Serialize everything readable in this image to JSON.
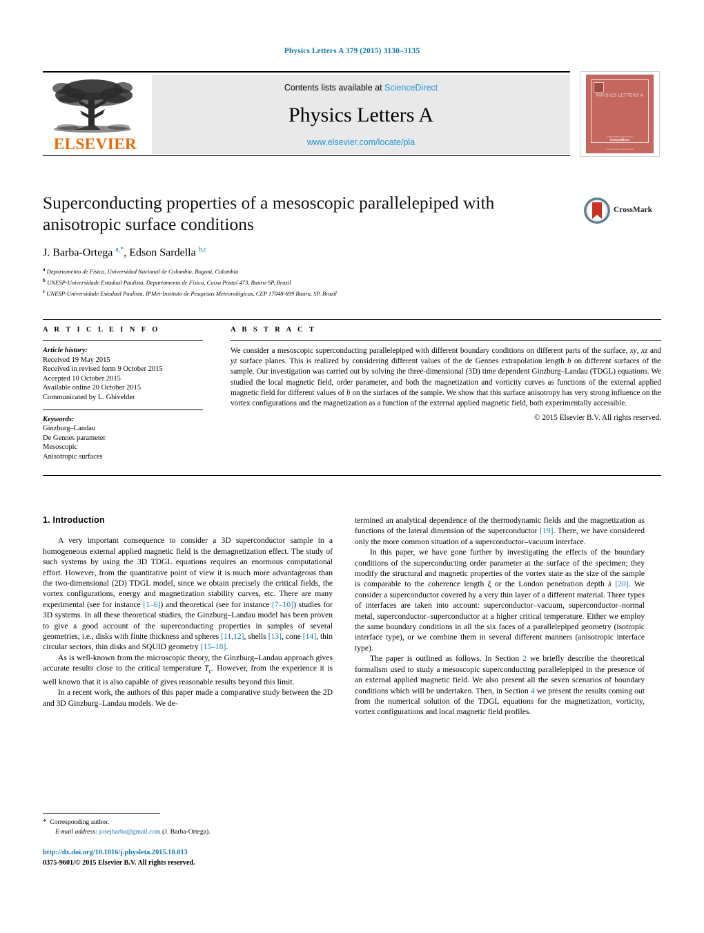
{
  "journal_ref": "Physics Letters A 379 (2015) 3130–3135",
  "masthead": {
    "contents_prefix": "Contents lists available at ",
    "sciencedirect": "ScienceDirect",
    "journal_title": "Physics Letters A",
    "journal_url": "www.elsevier.com/locate/pla",
    "publisher": "ELSEVIER",
    "cover": {
      "name": "PHYSICS LETTERS A",
      "foot1": "AVAILABLE ONLINE AT",
      "foot2": "ScienceDirect",
      "foot3": "www.elsevier.com/locate/pla"
    }
  },
  "article": {
    "title": "Superconducting properties of a mesoscopic parallelepiped with anisotropic surface conditions",
    "authors_html": "J. Barba-Ortega <sup>a,*</sup>, Edson Sardella <sup>b,c</sup>",
    "affiliations": [
      {
        "mark": "a",
        "text": "Departamento de Física, Universidad Nacional de Colombia, Bogotá, Colombia"
      },
      {
        "mark": "b",
        "text": "UNESP-Universidade Estadual Paulista, Departamento de Física, Caixa Postal 473, Bauru-SP, Brazil"
      },
      {
        "mark": "c",
        "text": "UNESP-Universidade Estadual Paulista, IPMet-Instituto de Pesquisas Meteorológicas, CEP 17048-699 Bauru, SP, Brazil"
      }
    ]
  },
  "crossmark": {
    "label": "CrossMark"
  },
  "info": {
    "heading": "A R T I C L E   I N F O",
    "history_label": "Article history:",
    "history": [
      "Received 19 May 2015",
      "Received in revised form 9 October 2015",
      "Accepted 10 October 2015",
      "Available online 20 October 2015",
      "Communicated by L. Ghivelder"
    ],
    "keywords_label": "Keywords:",
    "keywords": [
      "Ginzburg–Landau",
      "De Gennes parameter",
      "Mesoscopic",
      "Anisotropic surfaces"
    ]
  },
  "abstract": {
    "heading": "A B S T R A C T",
    "body_html": "We consider a mesoscopic superconducting parallelepiped with different boundary conditions on different parts of the surface, <em>xy</em>, <em>xz</em> and <em>yz</em> surface planes. This is realized by considering different values of the de Gennes extrapolation length <em>b</em> on different surfaces of the sample. Our investigation was carried out by solving the three-dimensional (3D) time dependent Ginzburg–Landau (TDGL) equations. We studied the local magnetic field, order parameter, and both the magnetization and vorticity curves as functions of the external applied magnetic field for different values of <em>b</em> on the surfaces of the sample. We show that this surface anisotropy has very strong influence on the vortex configurations and the magnetization as a function of the external applied magnetic field, both experimentally accessible.",
    "copyright": "© 2015 Elsevier B.V. All rights reserved."
  },
  "body": {
    "section_title": "1. Introduction",
    "left_paragraphs_html": [
      "A very important consequence to consider a 3D superconductor sample in a homogeneous external applied magnetic field is the demagnetization effect. The study of such systems by using the 3D TDGL equations requires an enormous computational effort. However, from the quantitative point of view it is much more advantageous than the two-dimensional (2D) TDGL model, since we obtain precisely the critical fields, the vortex configurations, energy and magnetization stability curves, etc. There are many experimental (see for instance <span class=\"ref\">[1–6]</span>) and theoretical (see for instance <span class=\"ref\">[7–10]</span>) studies for 3D systems. In all these theoretical studies, the Ginzburg–Landau model has been proven to give a good account of the superconducting properties in samples of several geometries, i.e., disks with finite thickness and spheres <span class=\"ref\">[11,12]</span>, shells <span class=\"ref\">[13]</span>, cone <span class=\"ref\">[14]</span>, thin circular sectors, thin disks and SQUID geometry <span class=\"ref\">[15–18]</span>.",
      "As is well-known from the microscopic theory, the Ginzburg–Landau approach gives accurate results close to the critical temperature <i>T<sub>c</sub></i>. However, from the experience it is well known that it is also capable of gives reasonable results beyond this limit.",
      "In a recent work, the authors of this paper made a comparative study between the 2D and 3D Ginzburg–Landau models. We de-"
    ],
    "right_paragraphs_html": [
      "termined an analytical dependence of the thermodynamic fields and the magnetization as functions of the lateral dimension of the superconductor <span class=\"ref\">[19]</span>. There, we have considered only the more common situation of a superconductor–vacuum interface.",
      "In this paper, we have gone further by investigating the effects of the boundary conditions of the superconducting order parameter at the surface of the specimen; they modify the structural and magnetic properties of the vortex state as the size of the sample is comparable to the coherence length <i>ξ</i> or the London penetration depth <i>λ</i> <span class=\"ref\">[20]</span>. We consider a superconductor covered by a very thin layer of a different material. Three types of interfaces are taken into account: superconductor–vacuum, superconductor–normal metal, superconductor–superconductor at a higher critical temperature. Either we employ the same boundary conditions in all the six faces of a parallelepiped geometry (isotropic interface type), or we combine them in several different manners (anisotropic interface type).",
      "The paper is outlined as follows. In Section <span class=\"ref\">2</span> we briefly describe the theoretical formalism used to study a mesoscopic superconducting parallelepiped in the presence of an external applied magnetic field. We also present all the seven scenarios of boundary conditions which will be undertaken. Then, in Section <span class=\"ref\">4</span> we present the results coming out from the numerical solution of the TDGL equations for the magnetization, vorticity, vortex configurations and local magnetic field profiles."
    ],
    "right_first_noindent": true
  },
  "footer": {
    "corresponding_author": "Corresponding author.",
    "email_label": "E-mail address:",
    "email": "josejbarba@gmail.com",
    "email_owner": "(J. Barba-Ortega).",
    "doi": "http://dx.doi.org/10.1016/j.physleta.2015.10.013",
    "issn_line": "0375-9601/© 2015 Elsevier B.V. All rights reserved."
  },
  "colors": {
    "link_blue": "#1577b0",
    "sciencedirect_blue": "#2196d6",
    "elsevier_orange": "#ec6707",
    "cover_red": "#c4675f"
  }
}
